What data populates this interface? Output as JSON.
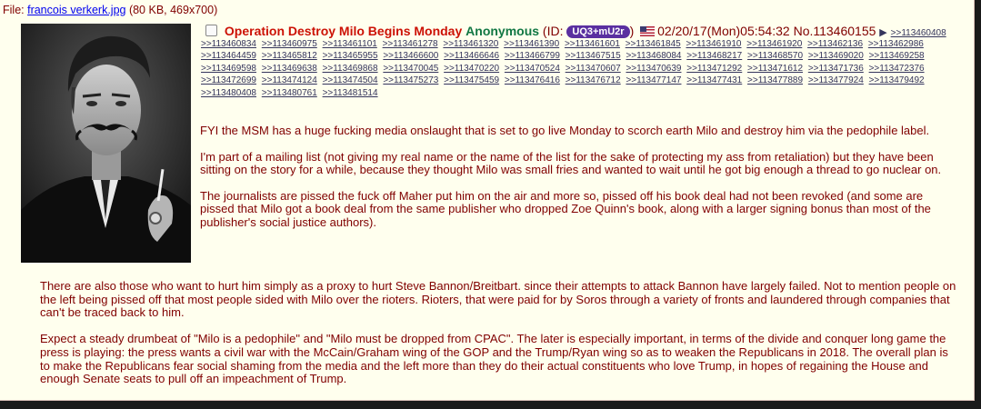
{
  "file": {
    "prefix": "File: ",
    "filename": "francois verkerk.jpg",
    "meta": " (80 KB, 469x700)"
  },
  "post": {
    "subject": "Operation Destroy Milo Begins Monday",
    "name": "Anonymous",
    "id_prefix": " (ID: ",
    "id": "UQ3+mU2r",
    "id_suffix": ")",
    "datetime": "02/20/17(Mon)05:54:32",
    "number": "No.113460155",
    "first_backlink": ">>113460408"
  },
  "backlinks": [
    ">>113460834",
    ">>113460975",
    ">>113461101",
    ">>113461278",
    ">>113461320",
    ">>113461390",
    ">>113461601",
    ">>113461845",
    ">>113461910",
    ">>113461920",
    ">>113462136",
    ">>113462986",
    ">>113464459",
    ">>113465812",
    ">>113465955",
    ">>113466600",
    ">>113466646",
    ">>113466799",
    ">>113467515",
    ">>113468084",
    ">>113468217",
    ">>113468570",
    ">>113469020",
    ">>113469258",
    ">>113469598",
    ">>113469638",
    ">>113469868",
    ">>113470045",
    ">>113470220",
    ">>113470524",
    ">>113470607",
    ">>113470639",
    ">>113471292",
    ">>113471612",
    ">>113471736",
    ">>113472376",
    ">>113472699",
    ">>113474124",
    ">>113474504",
    ">>113475273",
    ">>113475459",
    ">>113476416",
    ">>113476712",
    ">>113477147",
    ">>113477431",
    ">>113477889",
    ">>113477924",
    ">>113479492",
    ">>113480408",
    ">>113480761",
    ">>113481514"
  ],
  "paragraphs": [
    "FYI the MSM has a huge fucking media onslaught that is set to go live Monday to scorch earth Milo and destroy him via the pedophile label.",
    "I'm part of a mailing list (not giving my real name or the name of the list for the sake of protecting my ass from retaliation) but they have been sitting on the story for a while, because they thought Milo was small fries and wanted to wait until he got big enough a thread to go nuclear on.",
    "The journalists are pissed the fuck off Maher put him on the air and more so, pissed off his book deal had not been revoked (and some are pissed that Milo got a book deal from the same publisher who dropped Zoe Quinn's book, along with a larger signing bonus than most of the publisher's social justice authors).",
    "There are also those who want to hurt him simply as a proxy to hurt Steve Bannon/Breitbart. since their attempts to attack Bannon have largely failed. Not to mention people on the left being pissed off that most people sided with Milo over the rioters. Rioters, that were paid for by Soros through a variety of fronts and laundered through companies that can't be traced back to him.",
    "Expect a steady drumbeat of \"Milo is a pedophile\" and \"Milo must be dropped from CPAC\". The later is especially important, in terms of the divide and conquer long game the press is playing: the press wants a civil war with the McCain/Graham wing of the GOP and the Trump/Ryan wing so as to weaken the Republicans in 2018. The overall plan is to make the Republicans fear social shaming from the media and the left more than they do their actual constituents who love Trump, in hopes of regaining the House and enough Senate seats to pull off an impeachment of Trump."
  ]
}
